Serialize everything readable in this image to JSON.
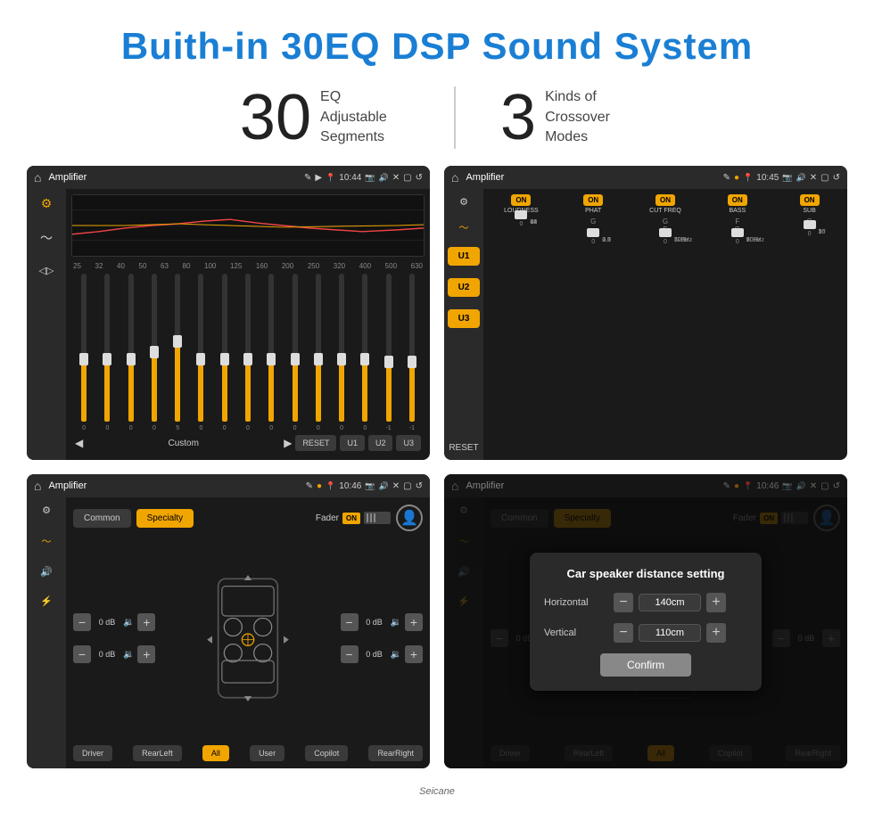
{
  "page": {
    "title": "Buith-in 30EQ DSP Sound System",
    "stat1_number": "30",
    "stat1_desc_line1": "EQ Adjustable",
    "stat1_desc_line2": "Segments",
    "stat2_number": "3",
    "stat2_desc_line1": "Kinds of",
    "stat2_desc_line2": "Crossover Modes"
  },
  "screen1": {
    "title": "Amplifier",
    "time": "10:44",
    "freq_labels": [
      "25",
      "32",
      "40",
      "50",
      "63",
      "80",
      "100",
      "125",
      "160",
      "200",
      "250",
      "320",
      "400",
      "500",
      "630"
    ],
    "slider_values": [
      "0",
      "0",
      "0",
      "0",
      "5",
      "0",
      "0",
      "0",
      "0",
      "0",
      "0",
      "0",
      "0",
      "-1",
      "0",
      "-1"
    ],
    "footer_buttons": [
      "RESET",
      "U1",
      "U2",
      "U3"
    ],
    "footer_text": "Custom"
  },
  "screen2": {
    "title": "Amplifier",
    "time": "10:45",
    "u_buttons": [
      "U1",
      "U2",
      "U3"
    ],
    "active_u": "U3",
    "reset_label": "RESET",
    "cols": [
      {
        "on": true,
        "label": "LOUDNESS"
      },
      {
        "on": true,
        "label": "PHAT"
      },
      {
        "on": true,
        "label": "CUT FREQ"
      },
      {
        "on": true,
        "label": "BASS"
      },
      {
        "on": true,
        "label": "SUB"
      }
    ]
  },
  "screen3": {
    "title": "Amplifier",
    "time": "10:46",
    "tabs": [
      "Common",
      "Specialty"
    ],
    "active_tab": "Specialty",
    "fader_label": "Fader",
    "fader_on": "ON",
    "db_values": [
      "0 dB",
      "0 dB",
      "0 dB",
      "0 dB"
    ],
    "footer_buttons": [
      "Driver",
      "RearLeft",
      "All",
      "User",
      "Copilot",
      "RearRight"
    ],
    "all_active": true
  },
  "screen4": {
    "title": "Amplifier",
    "time": "10:46",
    "tabs": [
      "Common",
      "Specialty"
    ],
    "active_tab": "Specialty",
    "dialog": {
      "title": "Car speaker distance setting",
      "horizontal_label": "Horizontal",
      "horizontal_value": "140cm",
      "vertical_label": "Vertical",
      "vertical_value": "110cm",
      "confirm_label": "Confirm"
    },
    "db_values": [
      "0 dB",
      "0 dB"
    ],
    "footer_buttons": [
      "Driver",
      "RearLeft",
      "All",
      "Copilot",
      "RearRight"
    ]
  },
  "watermark": "Seicane"
}
